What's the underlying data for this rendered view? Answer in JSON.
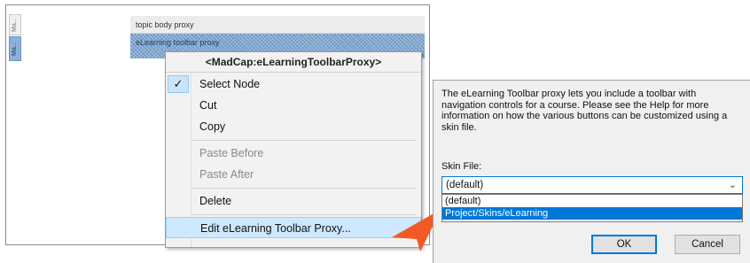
{
  "editor": {
    "side_tag_1": "Ma...",
    "side_tag_2": "Ma...",
    "topic_body_label": "topic body proxy",
    "elearning_bar_label": "eLearning toolbar proxy"
  },
  "context_menu": {
    "header": "<MadCap:eLearningToolbarProxy>",
    "check_glyph": "✓",
    "items": [
      {
        "label": "Select Node",
        "checked": true,
        "disabled": false
      },
      {
        "label": "Cut",
        "checked": false,
        "disabled": false
      },
      {
        "label": "Copy",
        "checked": false,
        "disabled": false
      },
      {
        "label": "Paste Before",
        "checked": false,
        "disabled": true
      },
      {
        "label": "Paste After",
        "checked": false,
        "disabled": true
      },
      {
        "label": "Delete",
        "checked": false,
        "disabled": false
      },
      {
        "label": "Edit eLearning Toolbar Proxy...",
        "checked": false,
        "disabled": false,
        "highlighted": true
      }
    ]
  },
  "dialog": {
    "description": "The eLearning Toolbar proxy lets you include a toolbar with navigation controls for a course. Please see the Help for more information on how the various buttons can be customized using a skin file.",
    "skin_label": "Skin File:",
    "skin_value": "(default)",
    "options": [
      "(default)",
      "Project/Skins/eLearning"
    ],
    "ok_label": "OK",
    "cancel_label": "Cancel"
  },
  "colors": {
    "accent": "#0078d7",
    "menu_highlight": "#cde8ff",
    "arrow": "#f15a24"
  }
}
